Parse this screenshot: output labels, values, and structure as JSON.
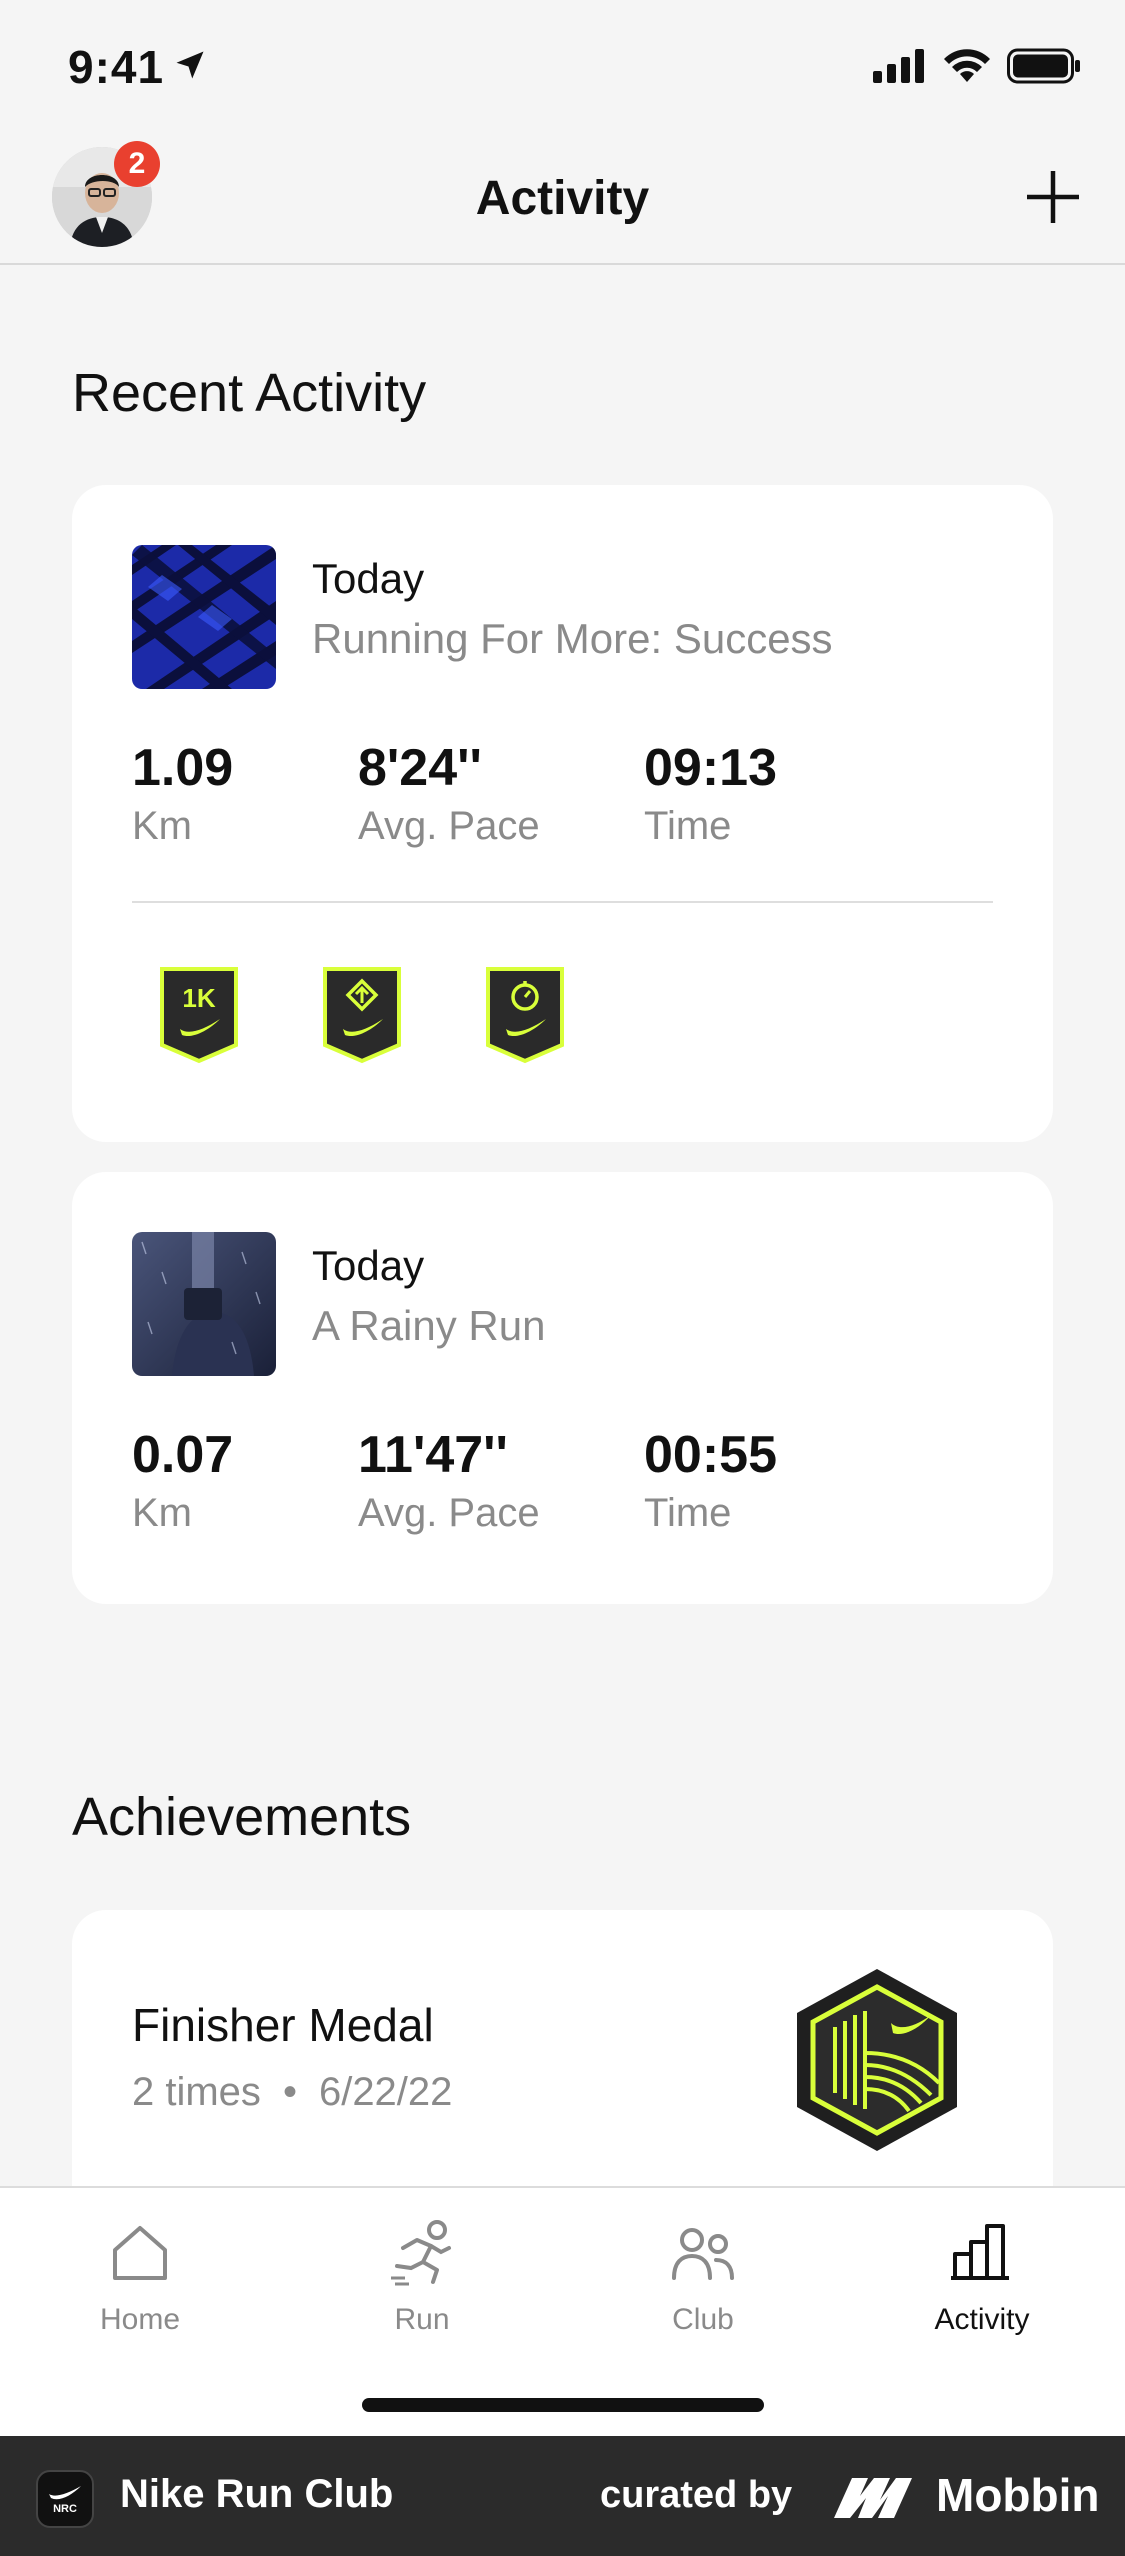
{
  "status_bar": {
    "time": "9:41"
  },
  "header": {
    "title": "Activity",
    "notification_count": "2"
  },
  "recent": {
    "section_title": "Recent Activity",
    "activities": [
      {
        "day": "Today",
        "name": "Running For More: Success",
        "stats": [
          {
            "value": "1.09",
            "label": "Km"
          },
          {
            "value": "8'24''",
            "label": "Avg. Pace"
          },
          {
            "value": "09:13",
            "label": "Time"
          }
        ],
        "badges": [
          {
            "text": "1K",
            "icon": "first-1k-badge"
          },
          {
            "text": "",
            "icon": "directional-badge"
          },
          {
            "text": "",
            "icon": "stopwatch-badge"
          }
        ]
      },
      {
        "day": "Today",
        "name": "A Rainy Run",
        "stats": [
          {
            "value": "0.07",
            "label": "Km"
          },
          {
            "value": "11'47''",
            "label": "Avg. Pace"
          },
          {
            "value": "00:55",
            "label": "Time"
          }
        ]
      }
    ]
  },
  "achievements": {
    "section_title": "Achievements",
    "items": [
      {
        "title": "Finisher Medal",
        "count": "2 times",
        "separator": "•",
        "date": "6/22/22"
      }
    ]
  },
  "tabs": [
    {
      "label": "Home",
      "icon": "home-icon",
      "active": false
    },
    {
      "label": "Run",
      "icon": "run-icon",
      "active": false
    },
    {
      "label": "Club",
      "icon": "club-icon",
      "active": false
    },
    {
      "label": "Activity",
      "icon": "activity-chart-icon",
      "active": true
    }
  ],
  "branding": {
    "app_name": "Nike Run Club",
    "app_icon_text": "NRC",
    "curated_by": "curated by",
    "brand": "Mobbin"
  },
  "colors": {
    "badge_red": "#e9402f",
    "volt": "#d9ff3a",
    "dark_badge": "#2a2a2a",
    "page_bg": "#f5f5f5"
  }
}
